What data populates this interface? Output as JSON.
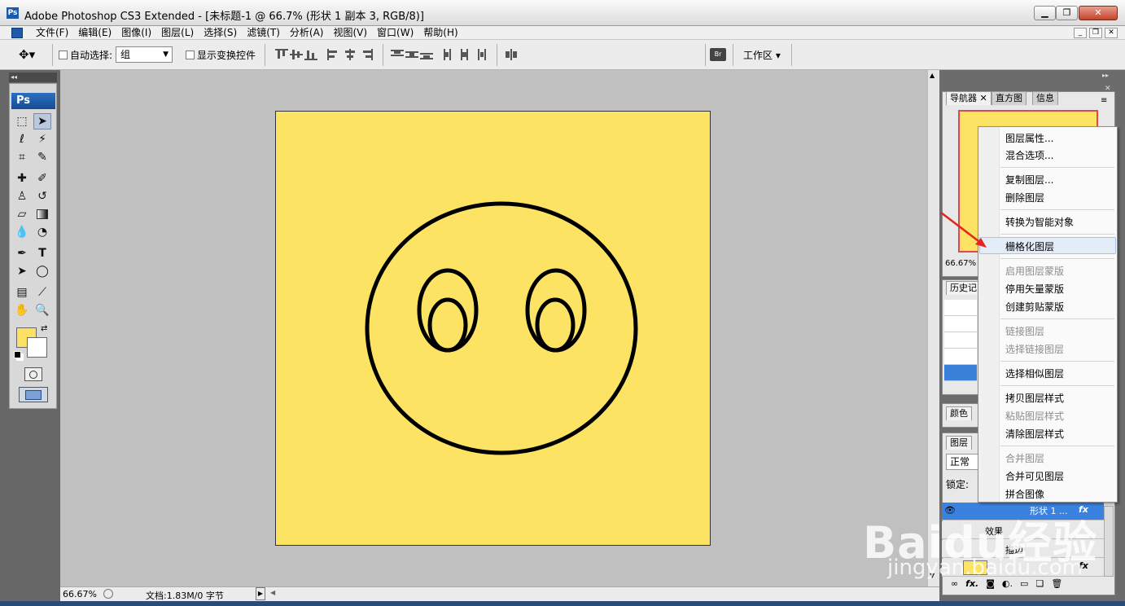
{
  "window": {
    "app_icon": "Ps",
    "title": "Adobe Photoshop CS3 Extended - [未标题-1 @ 66.7% (形状 1 副本 3, RGB/8)]",
    "buttons": [
      "minimize-icon",
      "restore-icon",
      "close-icon"
    ]
  },
  "menu": [
    "文件(F)",
    "编辑(E)",
    "图像(I)",
    "图层(L)",
    "选择(S)",
    "滤镜(T)",
    "分析(A)",
    "视图(V)",
    "窗口(W)",
    "帮助(H)"
  ],
  "options": {
    "auto_select_label": "自动选择:",
    "auto_select_value": "组",
    "show_transform_label": "显示变换控件",
    "workspace_label": "工作区"
  },
  "toolbox": {
    "logo": "Ps",
    "foreground_color": "#fde164",
    "background_color": "#ffffff"
  },
  "canvas": {
    "fill": "#fde363",
    "stroke": "#000000"
  },
  "status": {
    "zoom": "66.67%",
    "doc_info": "文档:1.83M/0 字节"
  },
  "panels": {
    "tabs_top": [
      "导航器",
      "直方图",
      "信息"
    ],
    "nav_zoom": "66.67%",
    "history_tab": "历史记",
    "color_tab": "颜色",
    "layers_tab": "图层",
    "blend_mode": "正常",
    "lock_label": "锁定:",
    "layer_name": "形状 1 ...",
    "effects_label": "效果",
    "stroke_label": "描边",
    "fx": "fx"
  },
  "context_menu": [
    {
      "label": "图层属性...",
      "disabled": false
    },
    {
      "label": "混合选项...",
      "disabled": false
    },
    {
      "label": "复制图层...",
      "disabled": false
    },
    {
      "label": "删除图层",
      "disabled": false
    },
    {
      "label": "转换为智能对象",
      "disabled": false
    },
    {
      "label": "栅格化图层",
      "disabled": false,
      "highlighted": true
    },
    {
      "label": "启用图层蒙版",
      "disabled": true
    },
    {
      "label": "停用矢量蒙版",
      "disabled": false
    },
    {
      "label": "创建剪贴蒙版",
      "disabled": false
    },
    {
      "label": "链接图层",
      "disabled": true
    },
    {
      "label": "选择链接图层",
      "disabled": true
    },
    {
      "label": "选择相似图层",
      "disabled": false
    },
    {
      "label": "拷贝图层样式",
      "disabled": false
    },
    {
      "label": "粘贴图层样式",
      "disabled": true
    },
    {
      "label": "清除图层样式",
      "disabled": false
    },
    {
      "label": "合并图层",
      "disabled": true
    },
    {
      "label": "合并可见图层",
      "disabled": false
    },
    {
      "label": "拼合图像",
      "disabled": false
    }
  ],
  "watermark": {
    "main": "Baidu经验",
    "sub": "jingyan.baidu.com"
  }
}
